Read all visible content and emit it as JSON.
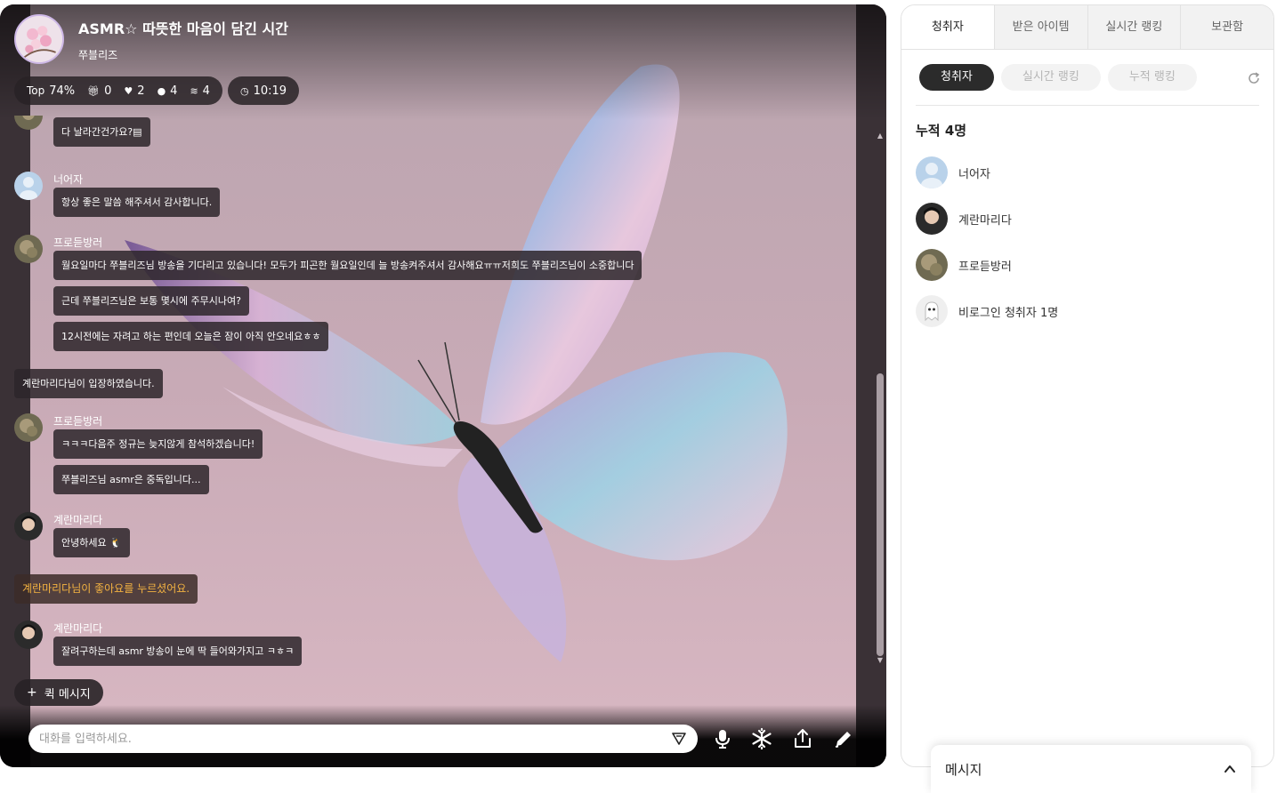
{
  "room": {
    "title": "ASMR☆ 따뜻한 마음이 담긴 시간",
    "host": "쭈블리즈"
  },
  "stats": {
    "top_label": "Top",
    "top_value": "74%",
    "gifts": "0",
    "likes": "2",
    "listeners": "4",
    "boosts": "4",
    "duration": "10:19"
  },
  "chat": {
    "partial_bubble": "다 날라간건가요?▤",
    "messages": [
      {
        "nick": "너어자",
        "lines": [
          "항상 좋은 말씀 해주셔서 감사합니다."
        ]
      },
      {
        "nick": "프로듣방러",
        "lines": [
          "월요일마다 쭈블리즈님 방송을 기다리고 있습니다! 모두가 피곤한 월요일인데 늘 방송켜주셔서 감사해요ㅠㅠ저희도 쭈블리즈님이 소중합니다",
          "근데 쭈블리즈님은 보통 몇시에 주무시나여?",
          "12시전에는 자려고 하는 편인데 오늘은 잠이 아직 안오네요ㅎㅎ"
        ]
      },
      {
        "nick": "프로듣방러",
        "lines": [
          "ㅋㅋㅋ다음주 정규는 늦지않게 참석하겠습니다!",
          "쭈블리즈님 asmr은 중독입니다..."
        ]
      },
      {
        "nick": "계란마리다",
        "lines": [
          "안녕하세요 🐧"
        ]
      },
      {
        "nick": "계란마리다",
        "lines": [
          "잘려구하는데 asmr 방송이 눈에 딱 들어와가지고 ㅋㅎㅋ"
        ]
      }
    ],
    "system_enter": "계란마리다님이 입장하였습니다.",
    "system_like": "계란마리다님이 좋아요를 누르셨어요."
  },
  "quick_message": "퀵 메시지",
  "input": {
    "placeholder": "대화를 입력하세요."
  },
  "panel": {
    "tabs": [
      "청취자",
      "받은 아이템",
      "실시간 랭킹",
      "보관함"
    ],
    "chips": [
      "청취자",
      "실시간 랭킹",
      "누적 랭킹"
    ],
    "total": "누적 4명",
    "listeners": [
      "너어자",
      "계란마리다",
      "프로듣방러",
      "비로그인 청취자 1명"
    ]
  },
  "message_panel": {
    "title": "메시지"
  },
  "colors": {
    "like_text": "#f4b341",
    "bubble_bg": "#2d262a",
    "active_chip": "#2b2b2b"
  }
}
